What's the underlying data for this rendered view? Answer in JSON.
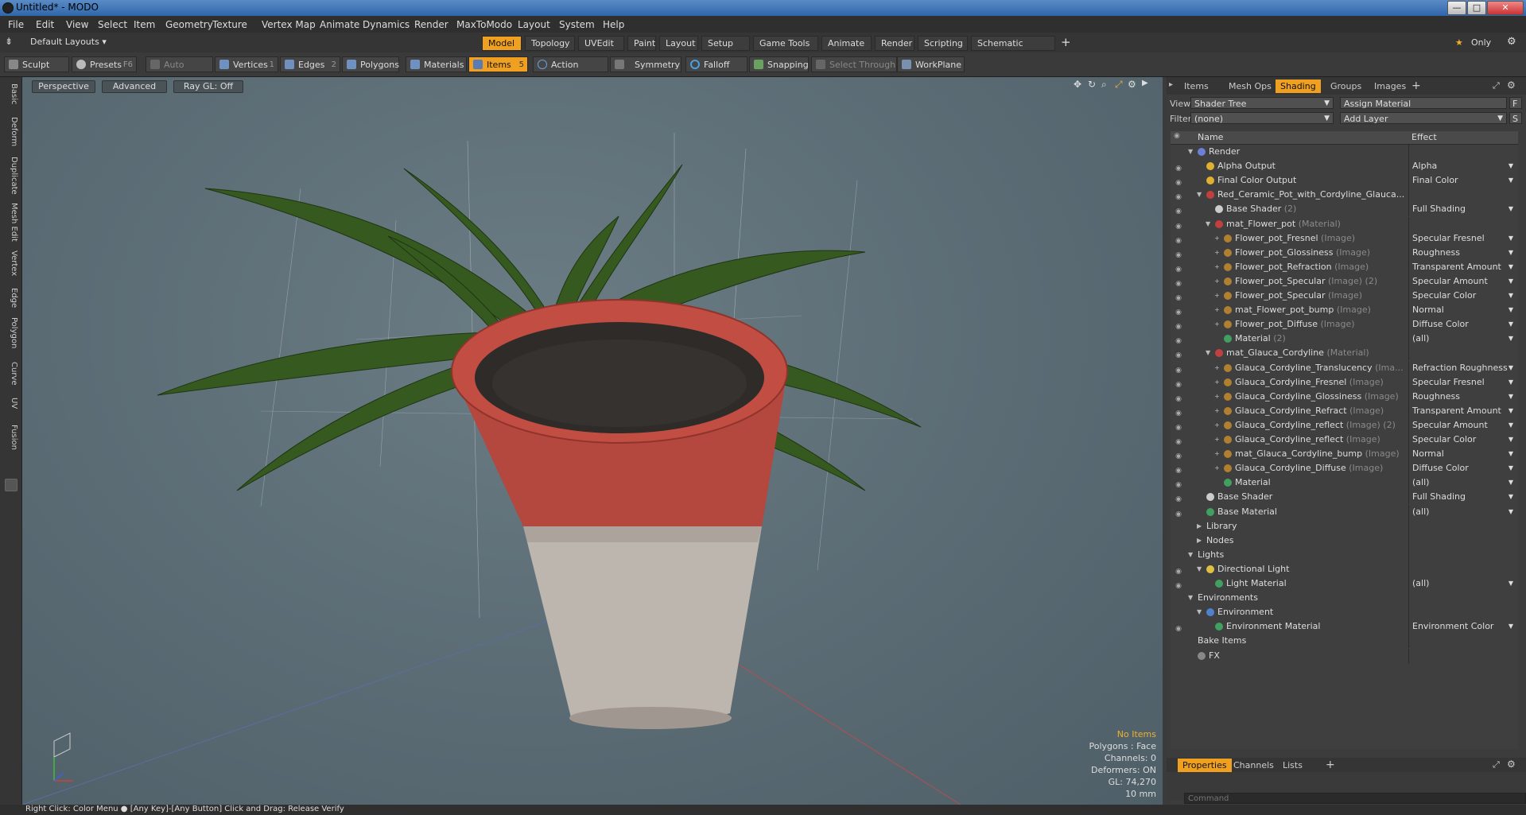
{
  "window": {
    "title": "Untitled* - MODO",
    "minimize": "—",
    "maximize": "□",
    "close": "✕"
  },
  "menu": [
    "File",
    "Edit",
    "View",
    "Select",
    "Item",
    "Geometry",
    "Texture",
    "Vertex Map",
    "Animate",
    "Dynamics",
    "Render",
    "MaxToModo",
    "Layout",
    "System",
    "Help"
  ],
  "layout_bar": {
    "layouts_dropdown": "Default Layouts",
    "tabs": [
      "Model",
      "Topology",
      "UVEdit",
      "Paint",
      "Layout",
      "Setup",
      "Game Tools",
      "Animate",
      "Render",
      "Scripting",
      "Schematic Fusion"
    ],
    "active_tab": "Model",
    "add": "+",
    "only": "Only",
    "star": "★",
    "gear": "⚙"
  },
  "toolbar": {
    "sculpt": "Sculpt",
    "presets": "Presets",
    "presets_key": "F6",
    "auto_select": "Auto Select",
    "vertices": "Vertices",
    "vertices_key": "1",
    "edges": "Edges",
    "edges_key": "2",
    "polygons": "Polygons",
    "materials": "Materials",
    "items": "Items",
    "items_key": "5",
    "action_center": "Action Center",
    "symmetry": "Symmetry",
    "falloff": "Falloff",
    "snapping": "Snapping",
    "select_through": "Select Through",
    "workplane": "WorkPlane"
  },
  "left_tabs": [
    "Basic",
    "Deform",
    "Duplicate",
    "Mesh Edit",
    "Vertex",
    "Edge",
    "Polygon",
    "Curve",
    "UV",
    "Fusion"
  ],
  "viewport": {
    "view_mode": "Perspective",
    "shading": "Advanced",
    "raygl": "Ray GL: Off",
    "info": {
      "items": "No Items",
      "polygons": "Polygons : Face",
      "channels": "Channels: 0",
      "deformers": "Deformers: ON",
      "gl": "GL: 74,270",
      "scale": "10 mm"
    }
  },
  "right_panel": {
    "tabs": [
      "Items",
      "Mesh Ops",
      "Shading",
      "Groups",
      "Images"
    ],
    "active_tab": "Shading",
    "view_label": "View",
    "view_value": "Shader Tree",
    "assign_material": "Assign Material",
    "f_btn": "F",
    "filter_label": "Filter",
    "filter_value": "(none)",
    "add_layer": "Add Layer",
    "s_btn": "S",
    "col_name": "Name",
    "col_effect": "Effect",
    "rows": [
      {
        "depth": 0,
        "expand": "▼",
        "name": "Render",
        "type": "",
        "effect": "",
        "icon": "#6e7fd6",
        "eye": false
      },
      {
        "depth": 1,
        "expand": "",
        "name": "Alpha Output",
        "type": "",
        "effect": "Alpha",
        "icon": "#e0b030",
        "eye": true
      },
      {
        "depth": 1,
        "expand": "",
        "name": "Final Color Output",
        "type": "",
        "effect": "Final Color",
        "icon": "#e0b030",
        "eye": true
      },
      {
        "depth": 1,
        "expand": "▼",
        "name": "Red_Ceramic_Pot_with_Cordyline_Glauca...",
        "type": "",
        "effect": "",
        "icon": "#c04040",
        "eye": true
      },
      {
        "depth": 2,
        "expand": "",
        "name": "Base Shader",
        "type": "(2)",
        "effect": "Full Shading",
        "icon": "#cccccc",
        "eye": true
      },
      {
        "depth": 2,
        "expand": "▼",
        "name": "mat_Flower_pot",
        "type": "(Material)",
        "effect": "",
        "icon": "#c04040",
        "eye": true
      },
      {
        "depth": 3,
        "expand": "+",
        "name": "Flower_pot_Fresnel",
        "type": "(Image)",
        "effect": "Specular Fresnel",
        "icon": "#b08030",
        "eye": true
      },
      {
        "depth": 3,
        "expand": "+",
        "name": "Flower_pot_Glossiness",
        "type": "(Image)",
        "effect": "Roughness",
        "icon": "#b08030",
        "eye": true
      },
      {
        "depth": 3,
        "expand": "+",
        "name": "Flower_pot_Refraction",
        "type": "(Image)",
        "effect": "Transparent Amount",
        "icon": "#b08030",
        "eye": true
      },
      {
        "depth": 3,
        "expand": "+",
        "name": "Flower_pot_Specular",
        "type": "(Image) (2)",
        "effect": "Specular Amount",
        "icon": "#b08030",
        "eye": true
      },
      {
        "depth": 3,
        "expand": "+",
        "name": "Flower_pot_Specular",
        "type": "(Image)",
        "effect": "Specular Color",
        "icon": "#b08030",
        "eye": true
      },
      {
        "depth": 3,
        "expand": "+",
        "name": "mat_Flower_pot_bump",
        "type": "(Image)",
        "effect": "Normal",
        "icon": "#b08030",
        "eye": true
      },
      {
        "depth": 3,
        "expand": "+",
        "name": "Flower_pot_Diffuse",
        "type": "(Image)",
        "effect": "Diffuse Color",
        "icon": "#b08030",
        "eye": true
      },
      {
        "depth": 3,
        "expand": "",
        "name": "Material",
        "type": "(2)",
        "effect": "(all)",
        "icon": "#40a060",
        "eye": true
      },
      {
        "depth": 2,
        "expand": "▼",
        "name": "mat_Glauca_Cordyline",
        "type": "(Material)",
        "effect": "",
        "icon": "#c04040",
        "eye": true
      },
      {
        "depth": 3,
        "expand": "+",
        "name": "Glauca_Cordyline_Translucency",
        "type": "(Ima...",
        "effect": "Refraction Roughness",
        "icon": "#b08030",
        "eye": true
      },
      {
        "depth": 3,
        "expand": "+",
        "name": "Glauca_Cordyline_Fresnel",
        "type": "(Image)",
        "effect": "Specular Fresnel",
        "icon": "#b08030",
        "eye": true
      },
      {
        "depth": 3,
        "expand": "+",
        "name": "Glauca_Cordyline_Glossiness",
        "type": "(Image)",
        "effect": "Roughness",
        "icon": "#b08030",
        "eye": true
      },
      {
        "depth": 3,
        "expand": "+",
        "name": "Glauca_Cordyline_Refract",
        "type": "(Image)",
        "effect": "Transparent Amount",
        "icon": "#b08030",
        "eye": true
      },
      {
        "depth": 3,
        "expand": "+",
        "name": "Glauca_Cordyline_reflect",
        "type": "(Image) (2)",
        "effect": "Specular Amount",
        "icon": "#b08030",
        "eye": true
      },
      {
        "depth": 3,
        "expand": "+",
        "name": "Glauca_Cordyline_reflect",
        "type": "(Image)",
        "effect": "Specular Color",
        "icon": "#b08030",
        "eye": true
      },
      {
        "depth": 3,
        "expand": "+",
        "name": "mat_Glauca_Cordyline_bump",
        "type": "(Image)",
        "effect": "Normal",
        "icon": "#b08030",
        "eye": true
      },
      {
        "depth": 3,
        "expand": "+",
        "name": "Glauca_Cordyline_Diffuse",
        "type": "(Image)",
        "effect": "Diffuse Color",
        "icon": "#b08030",
        "eye": true
      },
      {
        "depth": 3,
        "expand": "",
        "name": "Material",
        "type": "",
        "effect": "(all)",
        "icon": "#40a060",
        "eye": true
      },
      {
        "depth": 1,
        "expand": "",
        "name": "Base Shader",
        "type": "",
        "effect": "Full Shading",
        "icon": "#cccccc",
        "eye": true
      },
      {
        "depth": 1,
        "expand": "",
        "name": "Base Material",
        "type": "",
        "effect": "(all)",
        "icon": "#40a060",
        "eye": true
      },
      {
        "depth": 1,
        "expand": "▶",
        "name": "Library",
        "type": "",
        "effect": "",
        "icon": "",
        "eye": false
      },
      {
        "depth": 1,
        "expand": "▶",
        "name": "Nodes",
        "type": "",
        "effect": "",
        "icon": "",
        "eye": false
      },
      {
        "depth": 0,
        "expand": "▼",
        "name": "Lights",
        "type": "",
        "effect": "",
        "icon": "",
        "eye": false
      },
      {
        "depth": 1,
        "expand": "▼",
        "name": "Directional Light",
        "type": "",
        "effect": "",
        "icon": "#e0c040",
        "eye": true
      },
      {
        "depth": 2,
        "expand": "",
        "name": "Light Material",
        "type": "",
        "effect": "(all)",
        "icon": "#40a060",
        "eye": true
      },
      {
        "depth": 0,
        "expand": "▼",
        "name": "Environments",
        "type": "",
        "effect": "",
        "icon": "",
        "eye": false
      },
      {
        "depth": 1,
        "expand": "▼",
        "name": "Environment",
        "type": "",
        "effect": "",
        "icon": "#5080d0",
        "eye": false
      },
      {
        "depth": 2,
        "expand": "",
        "name": "Environment Material",
        "type": "",
        "effect": "Environment Color",
        "icon": "#40a060",
        "eye": true
      },
      {
        "depth": 0,
        "expand": "",
        "name": "Bake Items",
        "type": "",
        "effect": "",
        "icon": "",
        "eye": false
      },
      {
        "depth": 0,
        "expand": "",
        "name": "FX",
        "type": "",
        "effect": "",
        "icon": "#888888",
        "eye": false
      }
    ],
    "bottom_tabs": [
      "Properties",
      "Channels",
      "Lists"
    ],
    "bottom_active": "Properties",
    "command_placeholder": "Command"
  },
  "status": "Right Click: Color Menu  ●  [Any Key]-[Any Button] Click and Drag: Release Verify"
}
